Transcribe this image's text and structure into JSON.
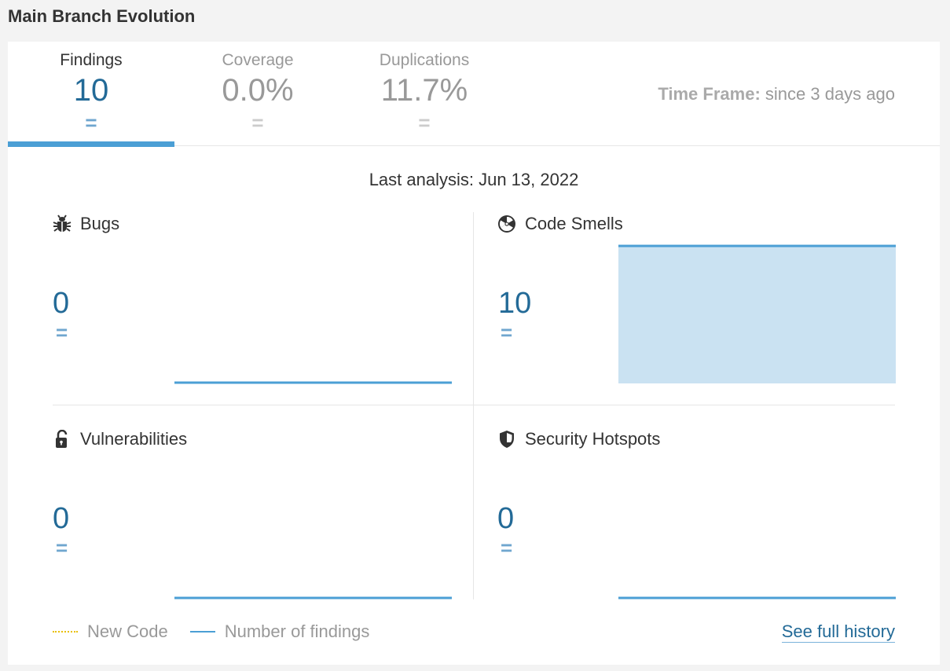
{
  "page": {
    "title": "Main Branch Evolution"
  },
  "tabs": [
    {
      "label": "Findings",
      "value": "10",
      "delta": "=",
      "active": true
    },
    {
      "label": "Coverage",
      "value": "0.0%",
      "delta": "=",
      "active": false
    },
    {
      "label": "Duplications",
      "value": "11.7%",
      "delta": "=",
      "active": false
    }
  ],
  "timeframe": {
    "label": "Time Frame:",
    "value": "since 3 days ago"
  },
  "last_analysis": "Last analysis: Jun 13, 2022",
  "panels": {
    "bugs": {
      "title": "Bugs",
      "value": "0",
      "delta": "=",
      "icon": "bug-icon"
    },
    "code_smells": {
      "title": "Code Smells",
      "value": "10",
      "delta": "=",
      "icon": "radiation-icon"
    },
    "vulnerabilities": {
      "title": "Vulnerabilities",
      "value": "0",
      "delta": "=",
      "icon": "unlocked-padlock-icon"
    },
    "security_hotspots": {
      "title": "Security Hotspots",
      "value": "0",
      "delta": "=",
      "icon": "shield-icon"
    }
  },
  "legend": {
    "new_code": "New Code",
    "number_of_findings": "Number of findings"
  },
  "links": {
    "see_full_history": "See full history"
  },
  "colors": {
    "accent": "#236a97",
    "line": "#4b9fd5",
    "area": "#cae2f2",
    "new_code": "#e9c000"
  }
}
